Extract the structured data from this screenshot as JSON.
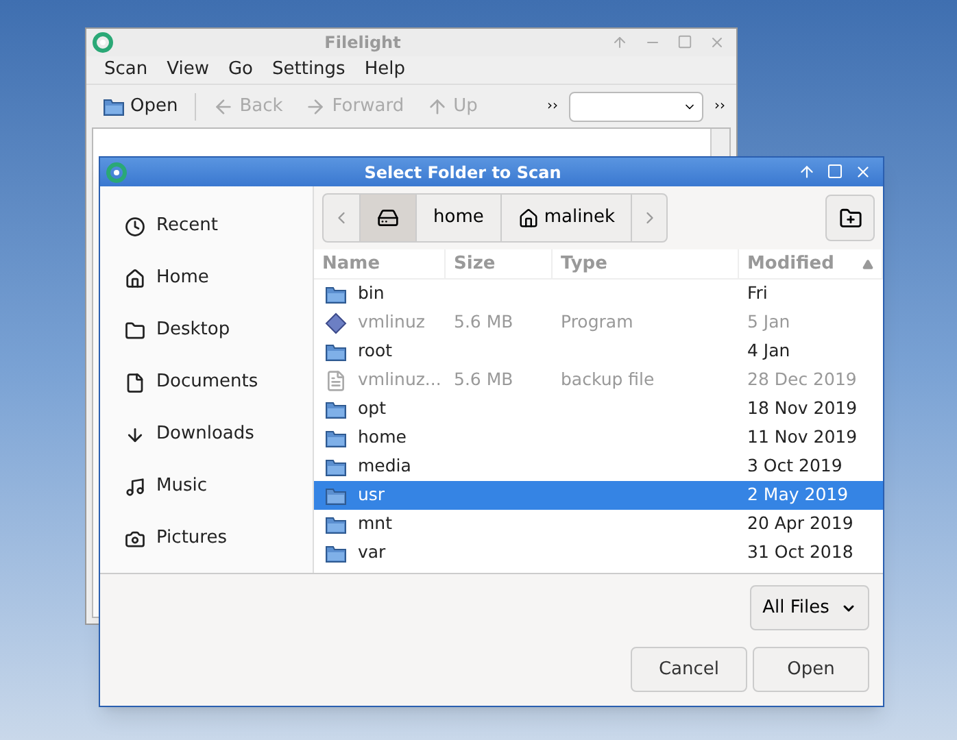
{
  "filelight": {
    "title": "Filelight",
    "menu": [
      "Scan",
      "View",
      "Go",
      "Settings",
      "Help"
    ],
    "toolbar": [
      {
        "label": "Open",
        "kind": "open",
        "disabled": false
      },
      {
        "label": "Back",
        "kind": "back",
        "disabled": true
      },
      {
        "label": "Forward",
        "kind": "forward",
        "disabled": true
      },
      {
        "label": "Up",
        "kind": "up",
        "disabled": true
      }
    ],
    "overflow_marks": [
      "››",
      "››"
    ]
  },
  "dialog": {
    "title": "Select Folder to Scan",
    "sidebar": [
      {
        "label": "Recent",
        "kind": "recent"
      },
      {
        "label": "Home",
        "kind": "home"
      },
      {
        "label": "Desktop",
        "kind": "desktop"
      },
      {
        "label": "Documents",
        "kind": "documents"
      },
      {
        "label": "Downloads",
        "kind": "downloads"
      },
      {
        "label": "Music",
        "kind": "music"
      },
      {
        "label": "Pictures",
        "kind": "pictures"
      }
    ],
    "path": [
      {
        "kind": "drive",
        "selected": true
      },
      {
        "label": "home",
        "kind": "folder",
        "selected": false
      },
      {
        "label": "malinek",
        "kind": "home",
        "selected": false
      }
    ],
    "columns": [
      {
        "label": "Name",
        "sorted": false
      },
      {
        "label": "Size",
        "sorted": false
      },
      {
        "label": "Type",
        "sorted": false
      },
      {
        "label": "Modified",
        "sorted": true
      }
    ],
    "rows": [
      {
        "name": "bin",
        "kind": "folder",
        "modified": "Fri",
        "selected": false
      },
      {
        "name": "vmlinuz",
        "kind": "program",
        "size": "5.6 MB",
        "type": "Program",
        "modified": "5 Jan",
        "selected": false
      },
      {
        "name": "root",
        "kind": "folder",
        "modified": "4 Jan",
        "selected": false
      },
      {
        "name": "vmlinuz...",
        "kind": "file",
        "size": "5.6 MB",
        "type": "backup file",
        "modified": "28 Dec 2019",
        "selected": false
      },
      {
        "name": "opt",
        "kind": "folder",
        "modified": "18 Nov 2019",
        "selected": false
      },
      {
        "name": "home",
        "kind": "folder",
        "modified": "11 Nov 2019",
        "selected": false
      },
      {
        "name": "media",
        "kind": "folder",
        "modified": "3 Oct 2019",
        "selected": false
      },
      {
        "name": "usr",
        "kind": "folder",
        "modified": "2 May 2019",
        "selected": true
      },
      {
        "name": "mnt",
        "kind": "folder",
        "modified": "20 Apr 2019",
        "selected": false
      },
      {
        "name": "var",
        "kind": "folder",
        "modified": "31 Oct 2018",
        "selected": false
      }
    ],
    "filter": "All Files",
    "buttons": [
      "Cancel",
      "Open"
    ]
  }
}
